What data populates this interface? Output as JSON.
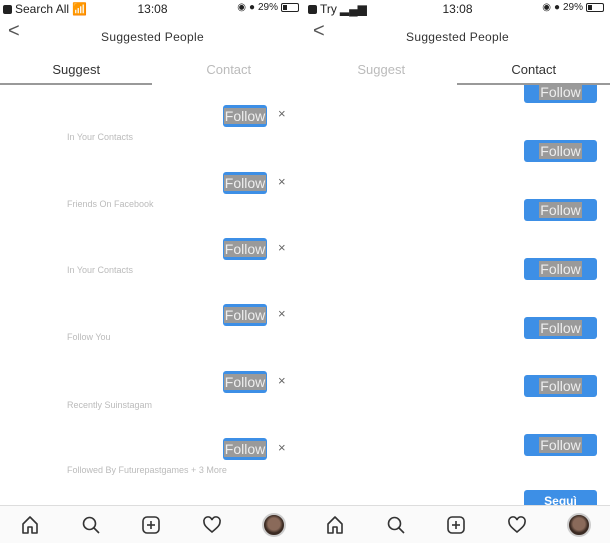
{
  "left": {
    "status": {
      "carrier": "Search All",
      "time": "13:08",
      "battery": "29%"
    },
    "header": {
      "back": "<",
      "title": "Suggested People"
    },
    "tabs": [
      {
        "label": "Suggest",
        "active": true
      },
      {
        "label": "Contact",
        "active": false
      }
    ],
    "rows": [
      {
        "subtitle": "In Your Contacts",
        "button": "Follow"
      },
      {
        "subtitle": "Friends On Facebook",
        "button": "Follow"
      },
      {
        "subtitle": "In Your Contacts",
        "button": "Follow"
      },
      {
        "subtitle": "Follow You",
        "button": "Follow"
      },
      {
        "subtitle": "Recently Suinstagam",
        "button": "Follow"
      },
      {
        "subtitle": "Followed By Futurepastgames + 3 More",
        "button": "Follow"
      }
    ],
    "dismiss": "×"
  },
  "right": {
    "status": {
      "carrier": "Try",
      "time": "13:08",
      "battery": "29%"
    },
    "header": {
      "back": "<",
      "title": "Suggested People"
    },
    "tabs": [
      {
        "label": "Suggest",
        "active": false
      },
      {
        "label": "Contact",
        "active": true
      }
    ],
    "buttons": [
      "Follow",
      "Follow",
      "Follow",
      "Follow",
      "Follow",
      "Follow",
      "Follow",
      "Seguì"
    ]
  },
  "nav": [
    "home-icon",
    "search-icon",
    "add-post-icon",
    "activity-heart-icon",
    "profile-avatar"
  ],
  "colors": {
    "accent": "#3d8fe6"
  }
}
